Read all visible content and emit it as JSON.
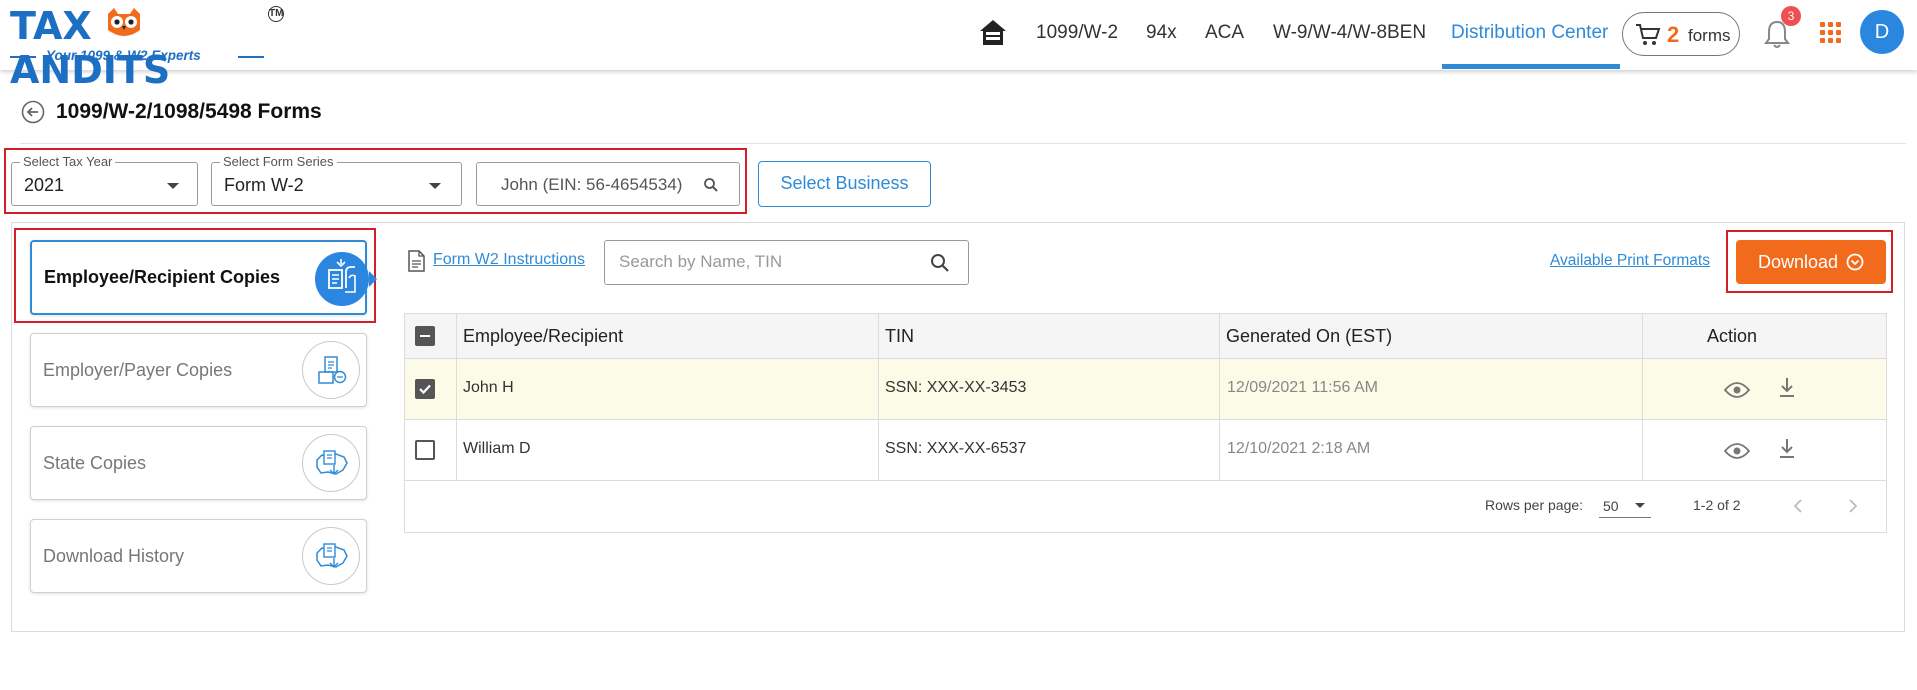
{
  "brand": {
    "name_left": "TAX",
    "name_right": "ANDITS",
    "trademark": "TM",
    "tagline": "Your 1099 & W2 Experts"
  },
  "nav": {
    "items": [
      "1099/W-2",
      "94x",
      "ACA",
      "W-9/W-4/W-8BEN",
      "Distribution Center"
    ],
    "active": "Distribution Center",
    "cart_count": "2",
    "cart_label": "forms",
    "notification_count": "3",
    "avatar_initial": "D"
  },
  "page": {
    "title": "1099/W-2/1098/5498 Forms"
  },
  "filters": {
    "tax_year_label": "Select Tax Year",
    "tax_year_value": "2021",
    "form_series_label": "Select Form Series",
    "form_series_value": "Form W-2",
    "business_value": "John (EIN: 56-4654534)",
    "select_business_button": "Select Business"
  },
  "sidebar": {
    "items": [
      {
        "label": "Employee/Recipient Copies",
        "active": true
      },
      {
        "label": "Employer/Payer Copies",
        "active": false
      },
      {
        "label": "State Copies",
        "active": false
      },
      {
        "label": "Download History",
        "active": false
      }
    ]
  },
  "toolbar": {
    "instructions_link": "Form W2 Instructions",
    "search_placeholder": "Search by Name, TIN",
    "print_formats_link": "Available Print Formats",
    "download_button": "Download"
  },
  "table": {
    "columns": [
      "Employee/Recipient",
      "TIN",
      "Generated On (EST)",
      "Action"
    ],
    "rows": [
      {
        "name": "John H",
        "tin": "SSN: XXX-XX-3453",
        "generated": "12/09/2021 11:56 AM",
        "checked": true
      },
      {
        "name": "William D",
        "tin": "SSN: XXX-XX-6537",
        "generated": "12/10/2021 2:18 AM",
        "checked": false
      }
    ],
    "rows_per_page_label": "Rows per page:",
    "rows_per_page_value": "50",
    "range_text": "1-2 of 2"
  },
  "colors": {
    "brand_blue": "#1d6fc4",
    "accent_blue": "#2f8bd8",
    "orange": "#f26b1d",
    "highlight_red": "#d21f2b",
    "badge_red": "#ef4f4f"
  }
}
